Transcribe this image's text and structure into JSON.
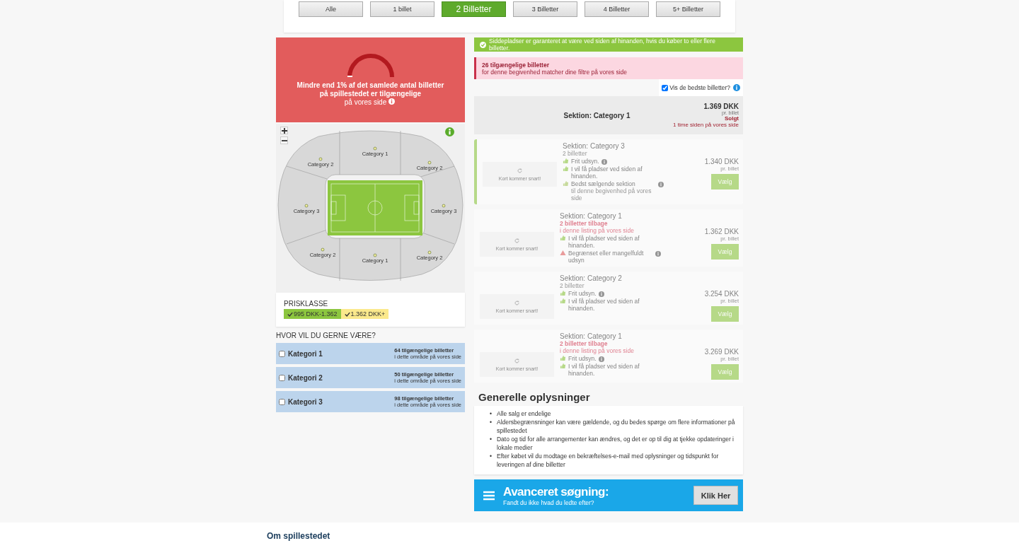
{
  "quantity_filter": [
    {
      "label": "Alle",
      "selected": false
    },
    {
      "label": "1 billet",
      "selected": false
    },
    {
      "label": "2 Billetter",
      "selected": true
    },
    {
      "label": "3 Billetter",
      "selected": false
    },
    {
      "label": "4 Billetter",
      "selected": false
    },
    {
      "label": "5+ Billetter",
      "selected": false
    }
  ],
  "scarcity": {
    "headline": "Mindre end 1% af det samlede antal billetter på spillestedet er tilgængelige",
    "sub": "på vores side"
  },
  "map": {
    "labels": [
      "Category 2",
      "Category 1",
      "Category 2",
      "Category 3",
      "Category 3",
      "Category 2",
      "Category 1",
      "Category 2"
    ]
  },
  "price_class": {
    "title": "PRISKLASSE",
    "ranges": [
      {
        "label": "995 DKK-1.362",
        "color": "#8cc63f"
      },
      {
        "label": "1.362 DKK+",
        "color": "#fbe98c"
      }
    ]
  },
  "area_filter": {
    "title": "HVOR VIL DU GERNE VÆRE?",
    "areas": [
      {
        "name": "Kategori 1",
        "checked": false,
        "count": "64 tilgængelige billetter",
        "note": "i dette område på vores side"
      },
      {
        "name": "Kategori 2",
        "checked": false,
        "count": "50 tilgængelige billetter",
        "note": "i dette område på vores side"
      },
      {
        "name": "Kategori 3",
        "checked": false,
        "count": "98 tilgængelige billetter",
        "note": "i dette område på vores side"
      }
    ]
  },
  "guarantee": "Siddepladser er garanteret at være ved siden af hinanden, hvis du køber to eller flere billetter.",
  "availability": {
    "count": "26 tilgængelige billetter",
    "note": "for denne begivenhed matcher dine filtre på vores side"
  },
  "best_tickets": {
    "label": "Vis de bedste billetter?",
    "checked": true
  },
  "sold": {
    "section": "Sektion: Category 1",
    "price": "1.369 DKK",
    "per": "pr. billet",
    "status": "Solgt",
    "time": "1 time siden på vores side"
  },
  "listings": [
    {
      "placeholder": "Kort kommer snart!",
      "section": "Sektion: Category 3",
      "quantity": "2 billetter",
      "quantity_warning": false,
      "features": [
        {
          "kind": "view",
          "text": "Frit udsyn.",
          "info": true
        },
        {
          "kind": "adjacent",
          "text": "I vil få pladser ved siden af hinanden."
        },
        {
          "kind": "bestseller",
          "text": "Bedst sælgende sektion",
          "sub": "til denne begivenhed på vores side",
          "info": true
        }
      ],
      "price": "1.340 DKK",
      "per": "pr. billet",
      "button": "Vælg",
      "highlighted": true
    },
    {
      "placeholder": "Kort kommer snart!",
      "section": "Sektion: Category 1",
      "quantity": "2 billetter tilbage",
      "quantity_warning": true,
      "note": "i denne listing på vores side",
      "features": [
        {
          "kind": "adjacent",
          "text": "I vil få pladser ved siden af hinanden."
        },
        {
          "kind": "restricted",
          "text": "Begrænset eller mangelfuldt udsyn",
          "info": true
        }
      ],
      "price": "1.362 DKK",
      "per": "pr. billet",
      "button": "Vælg",
      "highlighted": false
    },
    {
      "placeholder": "Kort kommer snart!",
      "section": "Sektion: Category 2",
      "quantity": "2 billetter",
      "quantity_warning": false,
      "features": [
        {
          "kind": "view",
          "text": "Frit udsyn.",
          "info": true
        },
        {
          "kind": "adjacent",
          "text": "I vil få pladser ved siden af hinanden."
        }
      ],
      "price": "3.254 DKK",
      "per": "pr. billet",
      "button": "Vælg",
      "highlighted": false
    },
    {
      "placeholder": "Kort kommer snart!",
      "section": "Sektion: Category 1",
      "quantity": "2 billetter tilbage",
      "quantity_warning": true,
      "note": "i denne listing på vores side",
      "features": [
        {
          "kind": "view",
          "text": "Frit udsyn.",
          "info": true
        },
        {
          "kind": "adjacent",
          "text": "I vil få pladser ved siden af hinanden."
        }
      ],
      "price": "3.269 DKK",
      "per": "pr. billet",
      "button": "Vælg",
      "highlighted": false
    }
  ],
  "general_info": {
    "title": "Generelle oplysninger",
    "bullet": "•",
    "items": [
      "Alle salg er endelige",
      "Aldersbegrænsninger kan være gældende, og du bedes spørge om flere informationer på spillestedet",
      "Dato og tid for alle arrangementer kan ændres, og det er op til dig at tjekke opdateringer i lokale medier",
      "Efter købet vil du modtage en bekræftelses-e-mail med oplysninger og tidspunkt for leveringen af dine billetter"
    ]
  },
  "advanced_search": {
    "title": "Avanceret søgning:",
    "subtitle": "Fandt du ikke hvad du ledte efter?",
    "button": "Klik Her"
  },
  "footer": {
    "heading": "Om spillestedet"
  }
}
